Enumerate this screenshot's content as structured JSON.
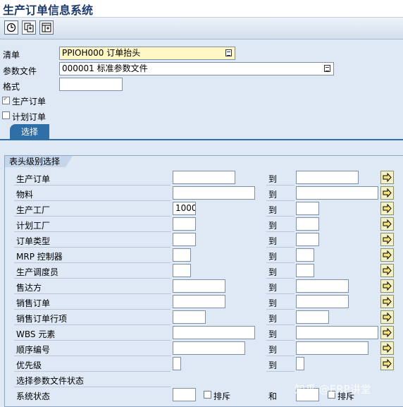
{
  "window": {
    "title": "生产订单信息系统"
  },
  "toolbar": {
    "buttons": [
      "execute-icon",
      "variant-icon",
      "dynamic-selection-icon"
    ]
  },
  "header": {
    "list_label": "清单",
    "list_value": "PPIOH000 订单抬头",
    "profile_label": "参数文件",
    "profile_value": "000001 标准参数文件",
    "layout_label": "格式",
    "layout_value": ""
  },
  "checkboxes": {
    "production_order": {
      "label": "生产订单",
      "checked": true
    },
    "planned_order": {
      "label": "计划订单",
      "checked": false
    }
  },
  "tabs": {
    "selection": "选择"
  },
  "group": {
    "title": "表头级别选择"
  },
  "to_label": "到",
  "rows": [
    {
      "label": "生产订单",
      "from": "",
      "to": ""
    },
    {
      "label": "物料",
      "from": "",
      "to": ""
    },
    {
      "label": "生产工厂",
      "from": "1000",
      "to": ""
    },
    {
      "label": "计划工厂",
      "from": "",
      "to": ""
    },
    {
      "label": "订单类型",
      "from": "",
      "to": ""
    },
    {
      "label": "MRP 控制器",
      "from": "",
      "to": ""
    },
    {
      "label": "生产调度员",
      "from": "",
      "to": ""
    },
    {
      "label": "售达方",
      "from": "",
      "to": ""
    },
    {
      "label": "销售订单",
      "from": "",
      "to": ""
    },
    {
      "label": "销售订单行项",
      "from": "",
      "to": ""
    },
    {
      "label": "WBS 元素",
      "from": "",
      "to": ""
    },
    {
      "label": "顺序编号",
      "from": "",
      "to": ""
    },
    {
      "label": "优先级",
      "from": "",
      "to": ""
    },
    {
      "label": "选择参数文件状态",
      "from": ""
    }
  ],
  "system_status": {
    "label": "系统状态",
    "exclude_label": "排斥",
    "and_label": "和",
    "exclude_label_2": "排斥"
  },
  "watermark": "知乎 @ERP讲堂"
}
